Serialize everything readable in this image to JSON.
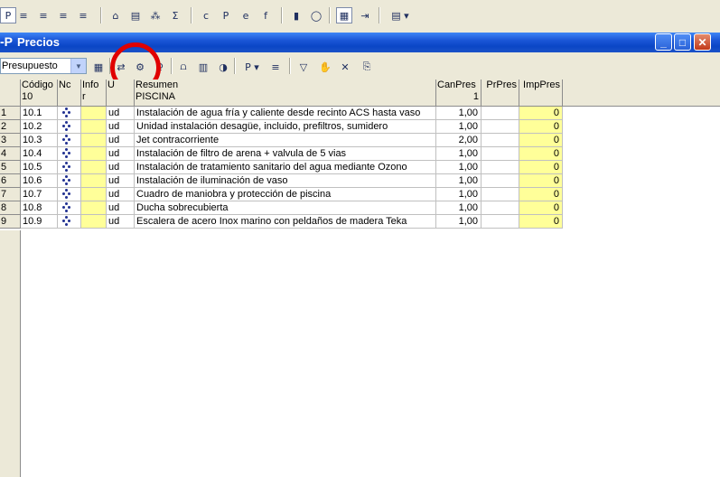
{
  "toolbar_top": {
    "icons": [
      "view-p-icon",
      "align-justify-icon",
      "align-right-icon",
      "align-left-icon",
      "align-center-icon",
      "tree-icon",
      "template-icon",
      "code-icon",
      "sigma-icon",
      "c-icon",
      "p-icon",
      "e-icon",
      "f-icon",
      "column-icon",
      "circle-icon",
      "calculator-icon",
      "export-icon",
      "menu-icon"
    ],
    "glyphs": [
      "P",
      "≡",
      "≡",
      "≡",
      "≡",
      "⌂",
      "▤",
      "⁂",
      "Σ",
      "c",
      "P",
      "e",
      "f",
      "▮",
      "◯",
      "▦",
      "⇥",
      "▤ ▾"
    ]
  },
  "window": {
    "title": "Precios",
    "icon_glyph": "-P",
    "minimize_glyph": "_",
    "maximize_glyph": "□",
    "close_glyph": "✕"
  },
  "toolbar2": {
    "combo_value": "Presupuesto",
    "combo_arrow": "▼",
    "glyphs": [
      "▦",
      "⇄",
      "⚙",
      "♀",
      "⩍",
      "▥",
      "◑",
      "P ▾",
      "≡",
      "▽",
      "✋",
      "✕",
      "⎘"
    ]
  },
  "grid": {
    "columns": [
      {
        "line1": "",
        "line2": ""
      },
      {
        "line1": "Código",
        "line2": "10"
      },
      {
        "line1": "Nc",
        "line2": ""
      },
      {
        "line1": "Info",
        "line2": "r"
      },
      {
        "line1": "U",
        "line2": ""
      },
      {
        "line1": "Resumen",
        "line2": "PISCINA"
      },
      {
        "line1": "CanPres",
        "line2": "1"
      },
      {
        "line1": "PrPres",
        "line2": ""
      },
      {
        "line1": "ImpPres",
        "line2": ""
      }
    ],
    "rows": [
      {
        "n": "1",
        "codigo": "10.1",
        "u": "ud",
        "resumen": "Instalación de agua fría y caliente desde recinto ACS hasta vaso",
        "canpres": "1,00",
        "imppres": "0"
      },
      {
        "n": "2",
        "codigo": "10.2",
        "u": "ud",
        "resumen": "Unidad instalación desagüe, incluido, prefiltros, sumidero",
        "canpres": "1,00",
        "imppres": "0"
      },
      {
        "n": "3",
        "codigo": "10.3",
        "u": "ud",
        "resumen": "Jet contracorriente",
        "canpres": "2,00",
        "imppres": "0"
      },
      {
        "n": "4",
        "codigo": "10.4",
        "u": "ud",
        "resumen": "Instalación de filtro de arena + valvula de 5 vias",
        "canpres": "1,00",
        "imppres": "0"
      },
      {
        "n": "5",
        "codigo": "10.5",
        "u": "ud",
        "resumen": "Instalación de tratamiento sanitario del agua mediante Ozono",
        "canpres": "1,00",
        "imppres": "0"
      },
      {
        "n": "6",
        "codigo": "10.6",
        "u": "ud",
        "resumen": "Instalación de iluminación de vaso",
        "canpres": "1,00",
        "imppres": "0"
      },
      {
        "n": "7",
        "codigo": "10.7",
        "u": "ud",
        "resumen": "Cuadro de maniobra y protección de piscina",
        "canpres": "1,00",
        "imppres": "0"
      },
      {
        "n": "8",
        "codigo": "10.8",
        "u": "ud",
        "resumen": "Ducha sobrecubierta",
        "canpres": "1,00",
        "imppres": "0"
      },
      {
        "n": "9",
        "codigo": "10.9",
        "u": "ud",
        "resumen": "Escalera de acero Inox marino con peldaños de madera Teka",
        "canpres": "1,00",
        "imppres": "0"
      }
    ]
  },
  "colors": {
    "title_bar": "#0a46c6",
    "yellow_cell": "#ffff99",
    "highlight_circle": "#e00000"
  }
}
